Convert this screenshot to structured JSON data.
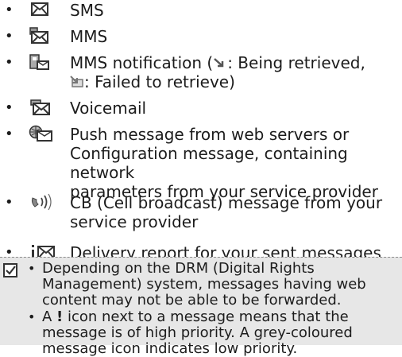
{
  "bullet_char": "•",
  "list": [
    {
      "icon": "envelope-icon",
      "text": "SMS"
    },
    {
      "icon": "mms-envelope-icon",
      "text": "MMS"
    },
    {
      "icon": "mms-notification-icon",
      "text_before": "MMS notification (",
      "retrieving_icon": "retrieving-arrow-icon",
      "text_middle": ": Being retrieved,\n",
      "failed_icon": "failed-envelope-icon",
      "text_after": ": Failed to retrieve)"
    },
    {
      "icon": "voicemail-icon",
      "text": "Voicemail"
    },
    {
      "icon": "push-message-icon",
      "text": "Push message from web servers or\nConfiguration message, containing network\nparameters from your service provider"
    },
    {
      "icon": "cell-broadcast-icon",
      "text": "CB (Cell broadcast) message from your\nservice provider"
    },
    {
      "icon": "delivery-report-icon",
      "text": "Delivery report for your sent messages"
    }
  ],
  "note": {
    "icon": "checkbox-icon",
    "items": [
      {
        "text": "Depending on the DRM (Digital Rights\nManagement) system, messages having web\ncontent may not be able to be forwarded."
      },
      {
        "text_before": "A ",
        "bold": "!",
        "text_after": " icon next to a message means that the\nmessage is of high priority. A grey-coloured\nmessage icon indicates low priority."
      }
    ]
  }
}
